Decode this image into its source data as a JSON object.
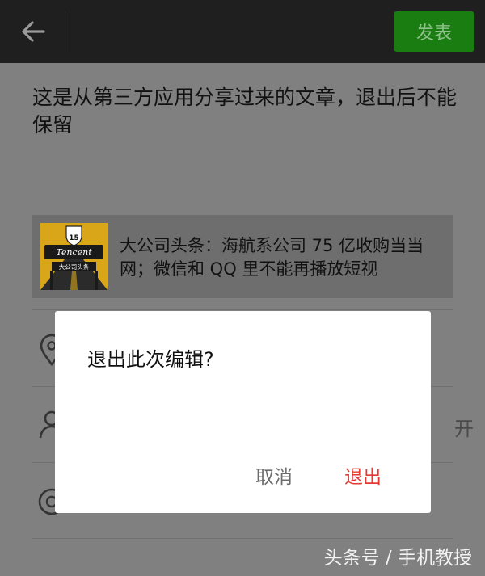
{
  "topbar": {
    "back_icon": "back-arrow-icon",
    "publish_label": "发表",
    "publish_color": "#1a7d12"
  },
  "notice": {
    "text": "这是从第三方应用分享过来的文章，退出后不能保留"
  },
  "share_card": {
    "thumbnail": {
      "badge_text": "15",
      "logo_text": "Tencent",
      "caption": "大公司头条"
    },
    "title": "大公司头条：海航系公司 75 亿收购当当网；微信和 QQ 里不能再播放短视"
  },
  "rows": [
    {
      "icon": "location-icon"
    },
    {
      "icon": "person-icon",
      "value": "开"
    },
    {
      "icon": "at-mention-icon"
    }
  ],
  "dialog": {
    "title": "退出此次编辑?",
    "cancel_label": "取消",
    "exit_label": "退出",
    "exit_color": "#e53935"
  },
  "watermark": "头条号 / 手机教授"
}
